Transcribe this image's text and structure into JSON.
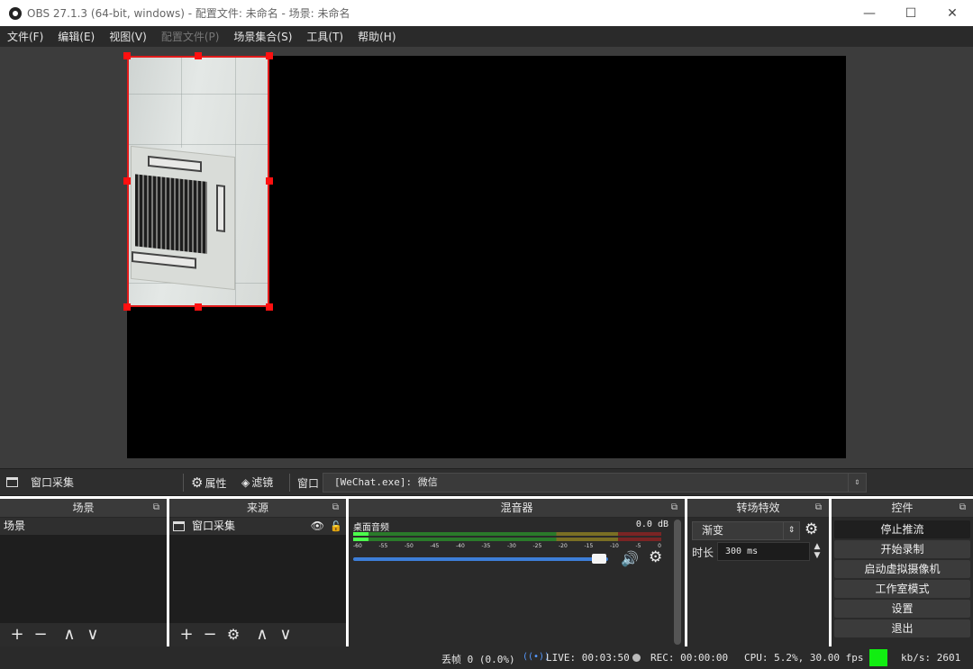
{
  "window": {
    "title": "OBS 27.1.3 (64-bit, windows) - 配置文件: 未命名 - 场景: 未命名",
    "minimize": "—",
    "maximize": "☐",
    "close": "✕"
  },
  "menu": [
    "文件(F)",
    "编辑(E)",
    "视图(V)",
    "配置文件(P)",
    "场景集合(S)",
    "工具(T)",
    "帮助(H)"
  ],
  "source_toolbar": {
    "source_name": "窗口采集",
    "properties_label": "属性",
    "filters_label": "滤镜",
    "window_label": "窗口",
    "window_value": "[WeChat.exe]: 微信"
  },
  "scenes": {
    "title": "场景",
    "items": [
      "场景"
    ]
  },
  "sources": {
    "title": "来源",
    "items": [
      {
        "name": "窗口采集",
        "visible": true,
        "locked": false
      }
    ]
  },
  "mixer": {
    "title": "混音器",
    "channels": [
      {
        "name": "桌面音频",
        "db": "0.0 dB",
        "level": 0.05
      }
    ],
    "ticks": [
      "-60",
      "-55",
      "-50",
      "-45",
      "-40",
      "-35",
      "-30",
      "-25",
      "-20",
      "-15",
      "-10",
      "-5",
      "0"
    ],
    "volume": 0.98
  },
  "transitions": {
    "title": "转场特效",
    "selected": "渐变",
    "duration_label": "时长",
    "duration_value": "300 ms"
  },
  "controls": {
    "title": "控件",
    "buttons": [
      "停止推流",
      "开始录制",
      "启动虚拟摄像机",
      "工作室模式",
      "设置",
      "退出"
    ]
  },
  "status": {
    "dropped": "丢帧 0 (0.0%)",
    "live": "LIVE: 00:03:50",
    "rec": "REC: 00:00:00",
    "cpu": "CPU: 5.2%, 30.00 fps",
    "kbs": "kb/s: 2601",
    "indicator_color": "#11ee11"
  },
  "icons": {
    "float": "⧉",
    "add": "+",
    "remove": "−",
    "up": "∧",
    "down": "∨",
    "gear": "⚙",
    "eye": "👁",
    "lock": "🔓",
    "speaker": "🔊",
    "spin": "⌃⌄",
    "live": "((•))"
  }
}
